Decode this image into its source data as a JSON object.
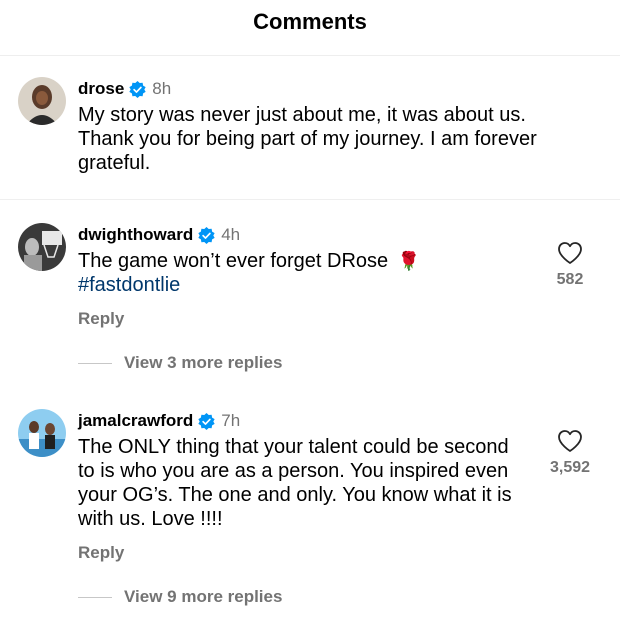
{
  "header": {
    "title": "Comments"
  },
  "comments": [
    {
      "username": "drose",
      "time": "8h",
      "lines": [
        "My story was never just about me, it was about us.",
        "Thank you for being part of my journey. I am forever",
        "grateful."
      ]
    },
    {
      "username": "dwighthoward",
      "time": "4h",
      "text": "The game won’t ever forget DRose",
      "emoji": "🌹",
      "hashtag": "#fastdontlie",
      "likes": "582",
      "reply_label": "Reply",
      "view_replies": "View 3 more replies"
    },
    {
      "username": "jamalcrawford",
      "time": "7h",
      "lines": [
        "The ONLY thing that your talent could be second",
        "to is who you are as a person. You inspired even",
        "your OG’s. The one and only. You know what it is",
        "with us. Love !!!!"
      ],
      "likes": "3,592",
      "reply_label": "Reply",
      "view_replies": "View 9 more replies"
    }
  ],
  "colors": {
    "verified": "#0095f6",
    "secondary_text": "#737373",
    "hashtag": "#00376b"
  },
  "icons": {
    "verified": "verified-badge-icon",
    "like": "heart-outline-icon"
  }
}
